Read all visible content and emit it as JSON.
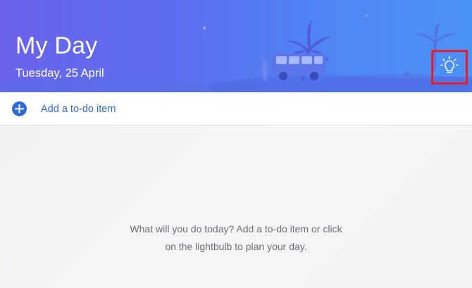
{
  "header": {
    "title": "My Day",
    "date": "Tuesday, 25 April",
    "suggestions_icon": "lightbulb-icon"
  },
  "add_item": {
    "icon": "plus-circle-icon",
    "label": "Add a to-do item"
  },
  "empty_state": {
    "line1": "What will you do today? Add a to-do item or click",
    "line2": "on the lightbulb to plan your day."
  },
  "colors": {
    "header_gradient_start": "#6a63ea",
    "header_gradient_end": "#4b92f5",
    "accent": "#2f6bd8",
    "highlight_box": "#e5202b"
  }
}
